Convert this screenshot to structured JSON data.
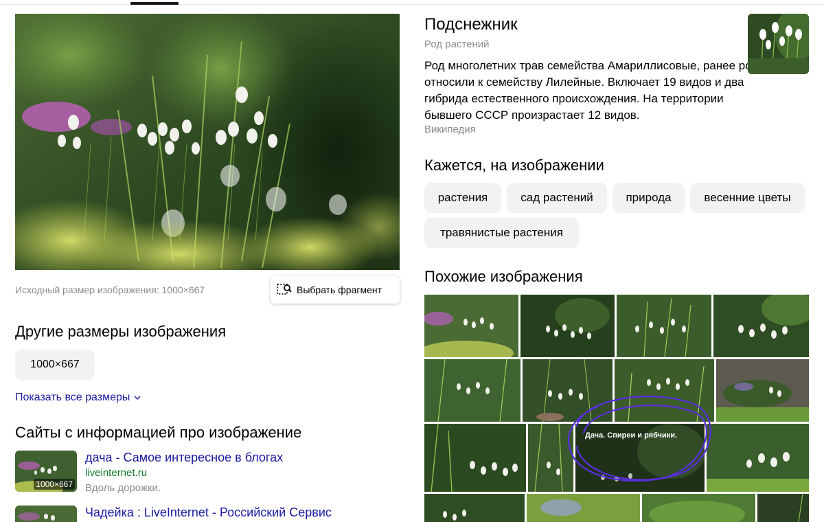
{
  "main": {
    "original_size_text": "Исходный размер изображения: 1000×667",
    "pick_fragment_label": "Выбрать фрагмент",
    "other_sizes_heading": "Другие размеры изображения",
    "size_options": [
      "1000×667"
    ],
    "show_all_sizes": "Показать все размеры",
    "sites_heading": "Сайты с информацией про изображение",
    "sites": [
      {
        "title": "дача - Самое интересное в блогах",
        "domain": "liveinternet.ru",
        "description": "Вдоль дорожки.",
        "thumb_size": "1000×667"
      },
      {
        "title": "Чадейка : LiveInternet - Российский Сервис",
        "domain": "",
        "description": "",
        "thumb_size": ""
      }
    ]
  },
  "entity": {
    "title": "Подснежник",
    "subtitle": "Род растений",
    "description": "Род многолетних трав семейства Амариллисовые, ранее род относили к семейству Лилейные. Включает 19 видов и два гибрида естественного происхождения. На территории бывшего СССР произрастает 12 видов.",
    "source": "Википедия"
  },
  "tags": {
    "heading": "Кажется, на изображении",
    "items": [
      "растения",
      "сад растений",
      "природа",
      "весенние цветы",
      "травянистые растения"
    ]
  },
  "similar": {
    "heading": "Похожие изображения",
    "caption": "Дача. Спиреи и рябчики.",
    "annotation_color": "#5a2ee0"
  },
  "colors": {
    "link": "#1a1aa3",
    "domain": "#0a7a2a",
    "muted": "#8c8c8c",
    "chip_bg": "#f2f2f4"
  },
  "icons": {
    "pick_fragment": "crop-select-icon",
    "show_all": "chevron-down-icon"
  }
}
